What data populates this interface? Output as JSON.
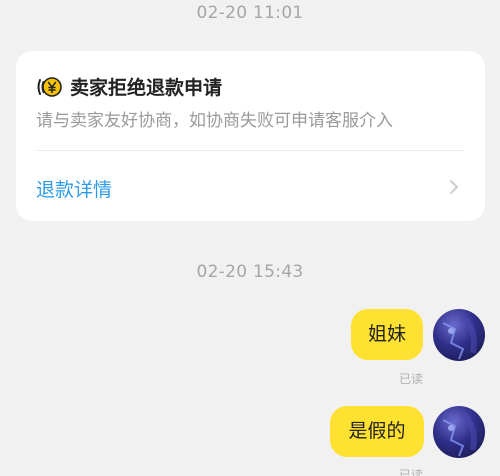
{
  "messages": {
    "timestamp_1": "02-20 11:01",
    "timestamp_2": "02-20 15:43"
  },
  "refund_card": {
    "icon": "yen-coin-icon",
    "title": "卖家拒绝退款申请",
    "subtitle": "请与卖家友好协商，如协商失败可申请客服介入",
    "link_label": "退款详情"
  },
  "chat": [
    {
      "text": "姐妹",
      "status": "已读"
    },
    {
      "text": "是假的",
      "status": "已读"
    }
  ],
  "colors": {
    "bubble": "#ffe131",
    "link": "#2f9ce9",
    "background": "#f1f1f1",
    "yen_badge": "#f6c500"
  }
}
